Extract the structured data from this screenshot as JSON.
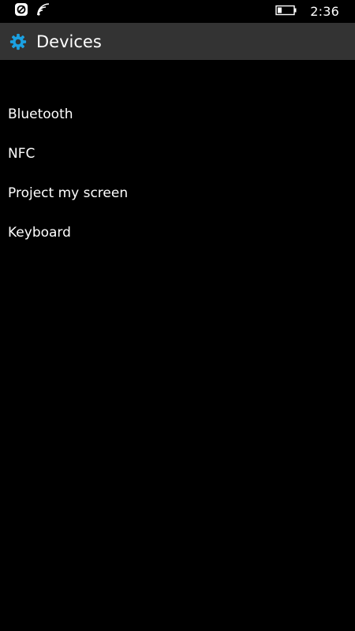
{
  "status_bar": {
    "time": "2:36",
    "icons": [
      "notification-icon",
      "wifi-icon",
      "battery-icon"
    ]
  },
  "header": {
    "icon": "gear-icon",
    "title": "Devices",
    "accent_color": "#1ba1e2",
    "background_color": "#333333"
  },
  "menu": {
    "items": [
      {
        "label": "Bluetooth"
      },
      {
        "label": "NFC"
      },
      {
        "label": "Project my screen"
      },
      {
        "label": "Keyboard"
      }
    ]
  },
  "colors": {
    "background": "#000000",
    "text": "#ffffff"
  }
}
